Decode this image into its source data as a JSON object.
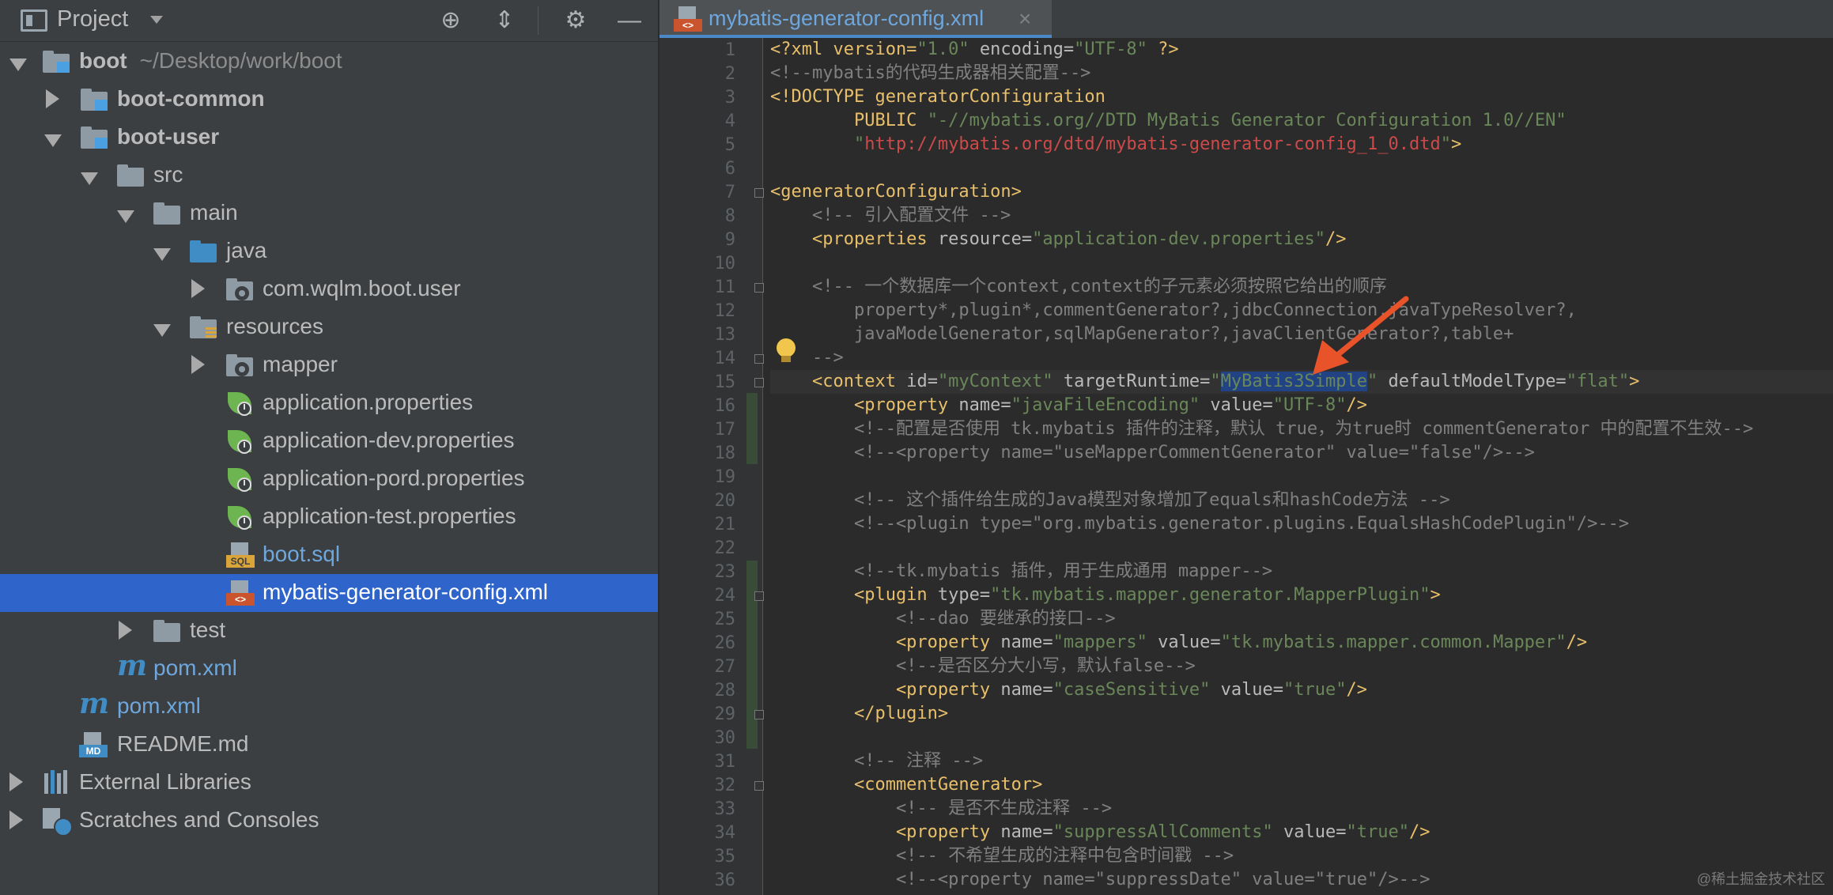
{
  "project_panel": {
    "title": "Project",
    "tree": [
      {
        "label": "boot",
        "sub": "~/Desktop/work/boot",
        "bold": true
      },
      {
        "label": "boot-common",
        "bold": true
      },
      {
        "label": "boot-user",
        "bold": true
      },
      {
        "label": "src"
      },
      {
        "label": "main"
      },
      {
        "label": "java"
      },
      {
        "label": "com.wqlm.boot.user"
      },
      {
        "label": "resources"
      },
      {
        "label": "mapper"
      },
      {
        "label": "application.properties"
      },
      {
        "label": "application-dev.properties"
      },
      {
        "label": "application-pord.properties"
      },
      {
        "label": "application-test.properties"
      },
      {
        "label": "boot.sql"
      },
      {
        "label": "mybatis-generator-config.xml"
      },
      {
        "label": "test"
      },
      {
        "label": "pom.xml"
      },
      {
        "label": "pom.xml"
      },
      {
        "label": "README.md"
      },
      {
        "label": "External Libraries"
      },
      {
        "label": "Scratches and Consoles"
      }
    ],
    "icons": {
      "sql_tag": "SQL",
      "md_tag": "MD",
      "xml_tag": "<>"
    }
  },
  "editor": {
    "tab_label": "mybatis-generator-config.xml",
    "tab_close": "×",
    "watermark": "@稀土掘金技术社区",
    "line_numbers": [
      "1",
      "2",
      "3",
      "4",
      "5",
      "6",
      "7",
      "8",
      "9",
      "10",
      "11",
      "12",
      "13",
      "14",
      "15",
      "16",
      "17",
      "18",
      "19",
      "20",
      "21",
      "22",
      "23",
      "24",
      "25",
      "26",
      "27",
      "28",
      "29",
      "30",
      "31",
      "32",
      "33",
      "34",
      "35",
      "36"
    ],
    "code": {
      "l1a": "<?xml version=",
      "l1b": "\"1.0\"",
      "l1c": " encoding=",
      "l1d": "\"UTF-8\"",
      "l1e": " ?>",
      "l2": "<!--mybatis的代码生成器相关配置-->",
      "l3": "<!DOCTYPE generatorConfiguration",
      "l4a": "        PUBLIC ",
      "l4b": "\"-//mybatis.org//DTD MyBatis Generator Configuration 1.0//EN\"",
      "l5a": "        \"",
      "l5b": "http://mybatis.org/dtd/mybatis-generator-config_1_0.dtd",
      "l5c": "\"",
      "l5d": ">",
      "l7": "<generatorConfiguration>",
      "l8": "    <!-- 引入配置文件 -->",
      "l9a": "    <properties",
      "l9b": " resource=",
      "l9c": "\"application-dev.properties\"",
      "l9d": "/>",
      "l11": "    <!-- 一个数据库一个context,context的子元素必须按照它给出的顺序",
      "l12": "        property*,plugin*,commentGenerator?,jdbcConnection,javaTypeResolver?,",
      "l13": "        javaModelGenerator,sqlMapGenerator?,javaClientGenerator?,table+",
      "l14": "    -->",
      "l15a": "    <context",
      "l15b": " id=",
      "l15c": "\"myContext\"",
      "l15d": " targetRuntime=",
      "l15e": "\"",
      "l15f": "MyBatis3Simple",
      "l15g": "\"",
      "l15h": " defaultModelType=",
      "l15i": "\"flat\"",
      "l15j": ">",
      "l16a": "        <property",
      "l16b": " name=",
      "l16c": "\"javaFileEncoding\"",
      "l16d": " value=",
      "l16e": "\"UTF-8\"",
      "l16f": "/>",
      "l17": "        <!--配置是否使用 tk.mybatis 插件的注释，默认 true，为true时 commentGenerator 中的配置不生效-->",
      "l18": "        <!--<property name=\"useMapperCommentGenerator\" value=\"false\"/>-->",
      "l20": "        <!-- 这个插件给生成的Java模型对象增加了equals和hashCode方法 -->",
      "l21": "        <!--<plugin type=\"org.mybatis.generator.plugins.EqualsHashCodePlugin\"/>-->",
      "l23": "        <!--tk.mybatis 插件，用于生成通用 mapper-->",
      "l24a": "        <plugin",
      "l24b": " type=",
      "l24c": "\"tk.mybatis.mapper.generator.MapperPlugin\"",
      "l24d": ">",
      "l25": "            <!--dao 要继承的接口-->",
      "l26a": "            <property",
      "l26b": " name=",
      "l26c": "\"mappers\"",
      "l26d": " value=",
      "l26e": "\"tk.mybatis.mapper.common.Mapper\"",
      "l26f": "/>",
      "l27": "            <!--是否区分大小写，默认false-->",
      "l28a": "            <property",
      "l28b": " name=",
      "l28c": "\"caseSensitive\"",
      "l28d": " value=",
      "l28e": "\"true\"",
      "l28f": "/>",
      "l29": "        </plugin>",
      "l31": "        <!-- 注释 -->",
      "l32": "        <commentGenerator>",
      "l33": "            <!-- 是否不生成注释 -->",
      "l34a": "            <property",
      "l34b": " name=",
      "l34c": "\"suppressAllComments\"",
      "l34d": " value=",
      "l34e": "\"true\"",
      "l34f": "/>",
      "l35": "            <!-- 不希望生成的注释中包含时间戳 -->",
      "l36": "            <!--<property name=\"suppressDate\" value=\"true\"/>-->"
    }
  },
  "colors": {
    "selection": "#2f65ca",
    "accent": "#4a88c7",
    "annotation_arrow": "#e8532a"
  }
}
